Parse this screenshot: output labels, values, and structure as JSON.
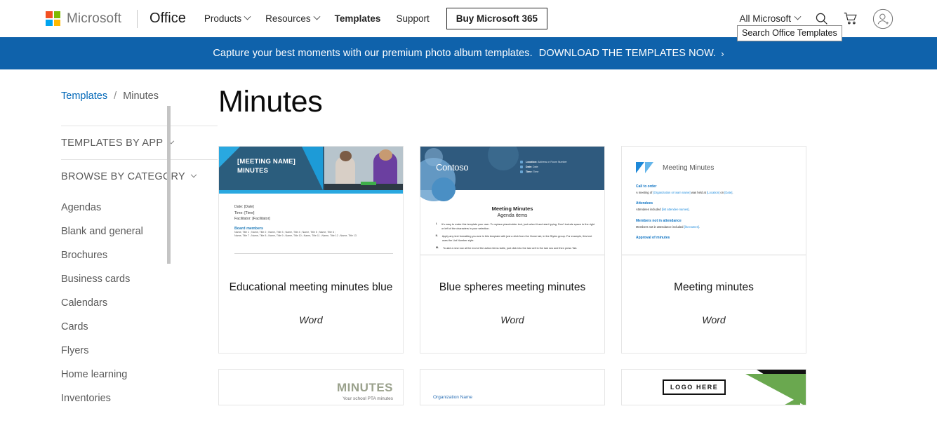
{
  "header": {
    "brand": "Microsoft",
    "product": "Office",
    "nav": [
      {
        "label": "Products",
        "has_chevron": true,
        "active": false
      },
      {
        "label": "Resources",
        "has_chevron": true,
        "active": false
      },
      {
        "label": "Templates",
        "has_chevron": false,
        "active": true
      },
      {
        "label": "Support",
        "has_chevron": false,
        "active": false
      }
    ],
    "buy_button": "Buy Microsoft 365",
    "all_microsoft": "All Microsoft",
    "search_icon": "search-icon",
    "cart_icon": "cart-icon",
    "account_icon": "account-icon",
    "tooltip": "Search Office Templates"
  },
  "promo": {
    "text": "Capture your best moments with our premium photo album templates.",
    "cta": "DOWNLOAD THE TEMPLATES NOW.",
    "arrow": "›",
    "background": "#0f62ab"
  },
  "breadcrumb": {
    "root": "Templates",
    "separator": "/",
    "current": "Minutes"
  },
  "sidebar": {
    "templates_by_app": "TEMPLATES BY APP",
    "browse_by_category": "BROWSE BY CATEGORY",
    "categories": [
      "Agendas",
      "Blank and general",
      "Brochures",
      "Business cards",
      "Calendars",
      "Cards",
      "Flyers",
      "Home learning",
      "Inventories"
    ]
  },
  "main": {
    "title": "Minutes",
    "cards": [
      {
        "title": "Educational meeting minutes blue",
        "app": "Word"
      },
      {
        "title": "Blue spheres meeting minutes",
        "app": "Word"
      },
      {
        "title": "Meeting minutes",
        "app": "Word"
      }
    ]
  },
  "thumbnails": {
    "card1": {
      "heading_line1": "[MEETING NAME]",
      "heading_line2": "MINUTES",
      "date": "Date:  [Date]",
      "time": "Time:  [Time]",
      "facilitator": "Facilitator:  [Facilitator]",
      "section": "Board members",
      "members_line1": "Name, Title 1 ; Name, Title 2 ; Name, Title 3 ; Name, Title 4 ; Name, Title 5 ; Name, Title 6 ;",
      "members_line2": "Name, Title 7 ; Name, Title 8 ; Name, Title 9 ; Name, Title 10 ; Name, Title 11 ; Name, Title 12 ; Name, Title 13"
    },
    "card2": {
      "logo": "Contoso",
      "meta_location_label": "Location:",
      "meta_location": "Address or Room Number",
      "meta_date_label": "Date:",
      "meta_date": "Date",
      "meta_time_label": "Time:",
      "meta_time": "Time",
      "title": "Meeting Minutes",
      "subtitle": "Agenda items",
      "items": [
        {
          "num": "I.",
          "text": "It's easy to make this template your own. To replace placeholder text, just select it and start typing. Don't include space to the right or left of the characters in your selection."
        },
        {
          "num": "II.",
          "text": "Apply any text formatting you see in this template with just a click from the Home tab, in the Styles group. For example, this text uses the List Number style."
        },
        {
          "num": "III.",
          "text": "To add a new row at the end of the action items table, just click into the last cell in the last row and then press Tab."
        }
      ]
    },
    "card3": {
      "logo_text": "Meeting Minutes",
      "h1": "Call to order",
      "p1_a": "A meeting of ",
      "p1_b": "[Organization or team name]",
      "p1_c": " was held at ",
      "p1_d": "[Location]",
      "p1_e": " on ",
      "p1_f": "[Date]",
      "p1_g": ".",
      "h2": "Attendees",
      "p2_a": "Attendees included ",
      "p2_b": "[list attendee names]",
      "p2_c": ".",
      "h3": "Members not in attendance",
      "p3_a": "Members not in attendance included ",
      "p3_b": "[list names]",
      "p3_c": ".",
      "h4": "Approval of minutes"
    },
    "row2": {
      "card4_title": "MINUTES",
      "card4_sub": "Your school PTA minutes",
      "card5_org": "Organization Name",
      "card6_logo": "LOGO HERE"
    }
  }
}
